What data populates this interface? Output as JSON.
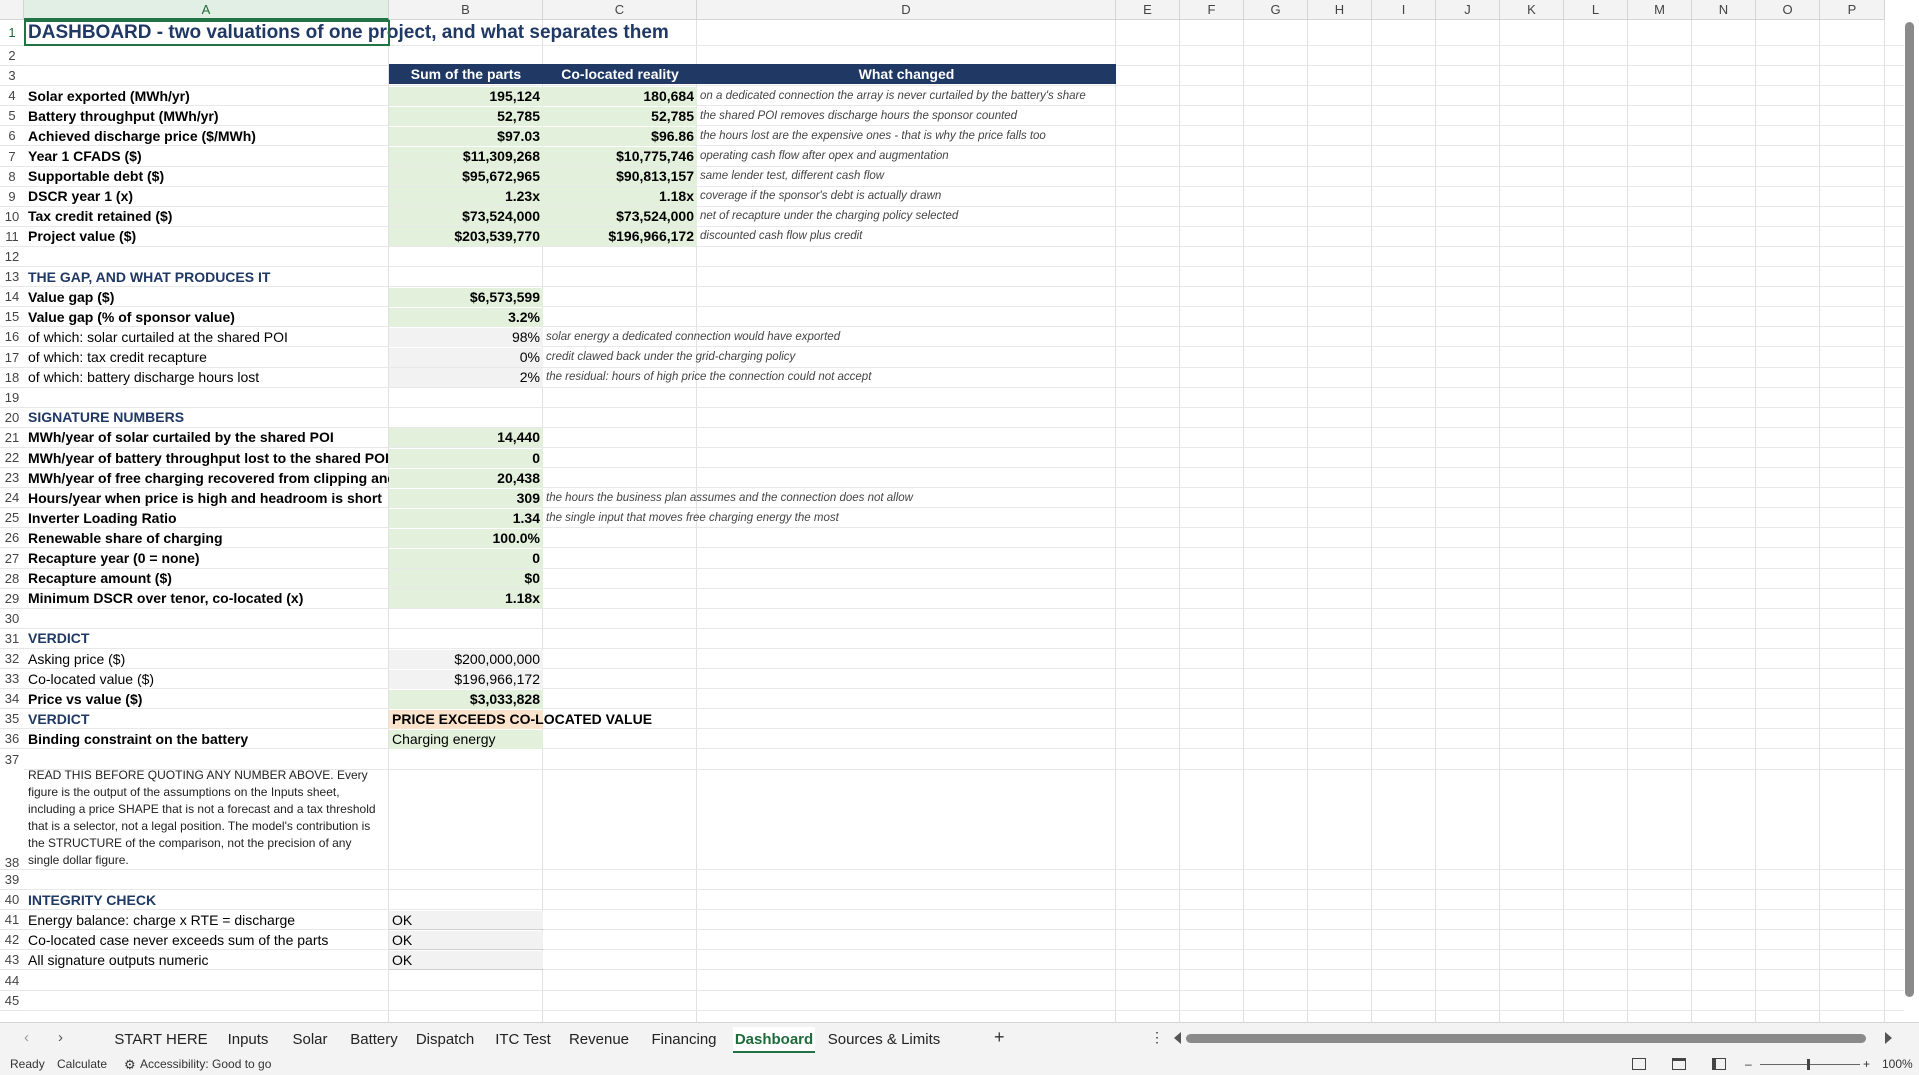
{
  "columns": [
    "A",
    "B",
    "C",
    "D",
    "E",
    "F",
    "G",
    "H",
    "I",
    "J",
    "K",
    "L",
    "M",
    "N",
    "O",
    "P"
  ],
  "rows": [
    "1",
    "2",
    "3",
    "4",
    "5",
    "6",
    "7",
    "8",
    "9",
    "10",
    "11",
    "12",
    "13",
    "14",
    "15",
    "16",
    "17",
    "18",
    "19",
    "20",
    "21",
    "22",
    "23",
    "24",
    "25",
    "26",
    "27",
    "28",
    "29",
    "30",
    "31",
    "32",
    "33",
    "34",
    "35",
    "36",
    "37",
    "38",
    "39",
    "40",
    "41",
    "42",
    "43",
    "44",
    "45"
  ],
  "title": "DASHBOARD - two valuations of one project, and what separates them",
  "table_headers": {
    "b": "Sum of the parts",
    "c": "Co-located reality",
    "d": "What changed"
  },
  "valuation_rows": [
    {
      "label": "Solar exported (MWh/yr)",
      "b": "195,124",
      "c": "180,684",
      "d": "on a dedicated connection the array is never curtailed by the battery's share"
    },
    {
      "label": "Battery throughput (MWh/yr)",
      "b": "52,785",
      "c": "52,785",
      "d": "the shared POI removes discharge hours the sponsor counted"
    },
    {
      "label": "Achieved discharge price ($/MWh)",
      "b": "$97.03",
      "c": "$96.86",
      "d": "the hours lost are the expensive ones - that is why the price falls too"
    },
    {
      "label": "Year 1 CFADS ($)",
      "b": "$11,309,268",
      "c": "$10,775,746",
      "d": "operating cash flow after opex and augmentation"
    },
    {
      "label": "Supportable debt ($)",
      "b": "$95,672,965",
      "c": "$90,813,157",
      "d": "same lender test, different cash flow"
    },
    {
      "label": "DSCR year 1 (x)",
      "b": "1.23x",
      "c": "1.18x",
      "d": "coverage if the sponsor's debt is actually drawn"
    },
    {
      "label": "Tax credit retained ($)",
      "b": "$73,524,000",
      "c": "$73,524,000",
      "d": "net of recapture under the charging policy selected"
    },
    {
      "label": "Project value ($)",
      "b": "$203,539,770",
      "c": "$196,966,172",
      "d": "discounted cash flow plus credit"
    }
  ],
  "gap_section": "THE GAP, AND WHAT PRODUCES IT",
  "gap_rows": [
    {
      "label": "Value gap ($)",
      "b": "$6,573,599",
      "note": ""
    },
    {
      "label": "Value gap (% of sponsor value)",
      "b": "3.2%",
      "note": ""
    },
    {
      "label": " of which: solar curtailed at the shared POI",
      "b": "98%",
      "note": "solar energy a dedicated connection would have exported"
    },
    {
      "label": " of which: tax credit recapture",
      "b": "0%",
      "note": "credit clawed back under the grid-charging policy"
    },
    {
      "label": " of which: battery discharge hours lost",
      "b": "2%",
      "note": "the residual: hours of high price the connection could not accept"
    }
  ],
  "signature_section": "SIGNATURE NUMBERS",
  "signature_rows": [
    {
      "label": "MWh/year of solar curtailed by the shared POI",
      "b": "14,440",
      "note": ""
    },
    {
      "label": "MWh/year of battery throughput lost to the shared POI",
      "b": "0",
      "note": ""
    },
    {
      "label": "MWh/year of free charging recovered from clipping and cu",
      "b": "20,438",
      "note": ""
    },
    {
      "label": "Hours/year when price is high and headroom is short",
      "b": "309",
      "note": "the hours the business plan assumes and the connection does not allow"
    },
    {
      "label": "Inverter Loading Ratio",
      "b": "1.34",
      "note": "the single input that moves free charging energy the most"
    },
    {
      "label": "Renewable share of charging",
      "b": "100.0%",
      "note": ""
    },
    {
      "label": "Recapture year (0 = none)",
      "b": "0",
      "note": ""
    },
    {
      "label": "Recapture amount ($)",
      "b": "$0",
      "note": ""
    },
    {
      "label": "Minimum DSCR over tenor, co-located (x)",
      "b": "1.18x",
      "note": ""
    }
  ],
  "verdict_section": "VERDICT",
  "verdict_rows": [
    {
      "label": "Asking price ($)",
      "b": "$200,000,000"
    },
    {
      "label": "Co-located value ($)",
      "b": "$196,966,172"
    },
    {
      "label": "Price vs value ($)",
      "b": "$3,033,828"
    }
  ],
  "verdict_label": "VERDICT",
  "verdict_value": "PRICE EXCEEDS CO-LOCATED VALUE",
  "binding_label": "Binding constraint on the battery",
  "binding_value": "Charging energy",
  "disclaimer": "READ THIS BEFORE QUOTING ANY NUMBER ABOVE. Every figure is the output of the assumptions on the Inputs sheet, including a price SHAPE that is not a forecast and a tax threshold that is a selector, not a legal position. The model's contribution is the STRUCTURE of the comparison, not the precision of any single dollar figure.",
  "integrity_section": "INTEGRITY CHECK",
  "integrity_rows": [
    {
      "label": "Energy balance: charge x RTE = discharge",
      "b": "OK"
    },
    {
      "label": "Co-located case never exceeds sum of the parts",
      "b": "OK"
    },
    {
      "label": "All signature outputs numeric",
      "b": "OK"
    }
  ],
  "tabs": [
    "START HERE",
    "Inputs",
    "Solar",
    "Battery",
    "Dispatch",
    "ITC Test",
    "Revenue",
    "Financing",
    "Dashboard",
    "Sources & Limits"
  ],
  "active_tab": "Dashboard",
  "add_sheet": "+",
  "status": {
    "ready": "Ready",
    "calculate": "Calculate",
    "accessibility": "Accessibility: Good to go",
    "zoom": "100%"
  },
  "colors": {
    "accent": "#217346",
    "header_band": "#1f3864",
    "input_fill": "#e3f0dc"
  }
}
